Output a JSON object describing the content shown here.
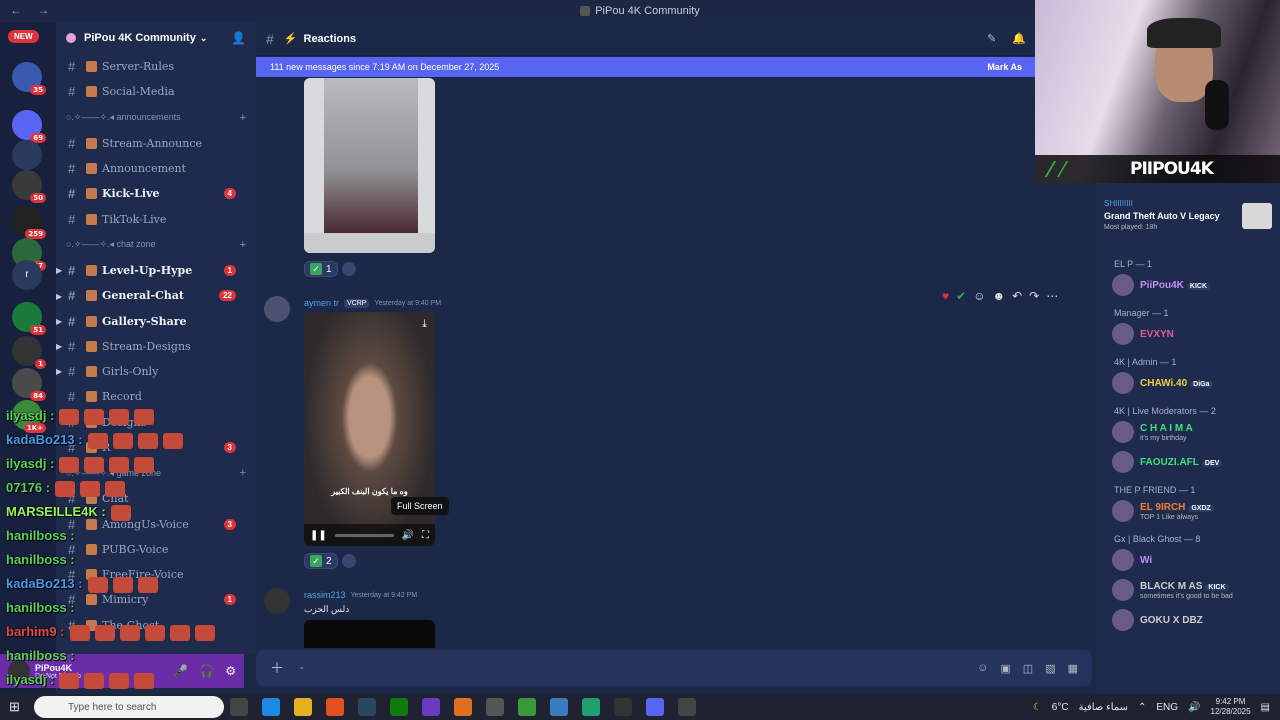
{
  "window": {
    "title": "PiPou 4K Community",
    "nav": "← →"
  },
  "rail": {
    "new_label": "NEW",
    "badges": [
      "35",
      "69",
      "50",
      "259",
      "287",
      "51",
      "1",
      "84",
      "1K+"
    ],
    "letter": "r"
  },
  "sidebar": {
    "guild_name": "PiPou 4K Community",
    "channels": [
      {
        "name": "Server-Rules"
      },
      {
        "name": "Social-Media"
      },
      {
        "category": "announcements"
      },
      {
        "name": "Stream-Announce"
      },
      {
        "name": "Announcement"
      },
      {
        "name": "Kick-Live",
        "badge": "4"
      },
      {
        "name": "TikTok-Live"
      },
      {
        "category": "chat zone"
      },
      {
        "name": "Level-Up-Hype",
        "badge": "1"
      },
      {
        "name": "General-Chat",
        "badge": "22"
      },
      {
        "name": "Gallery-Share"
      },
      {
        "name": "Stream-Designs"
      },
      {
        "name": "Girls-Only"
      },
      {
        "name": "Record"
      },
      {
        "name": "Designs"
      },
      {
        "name": "R",
        "badge": "3"
      },
      {
        "category": "game zone"
      },
      {
        "name": "Chat"
      },
      {
        "name": "AmongUs-Voice",
        "badge": "3"
      },
      {
        "name": "PUBG-Voice"
      },
      {
        "name": "FreeFire-Voice"
      },
      {
        "name": "Mimicry",
        "badge": "1"
      },
      {
        "name": "The-Ghost"
      }
    ]
  },
  "user_panel": {
    "name": "PiPou4K",
    "status": "Do Not Disturb"
  },
  "chat": {
    "channel": "Reactions",
    "banner_text": "111 new messages since 7:19 AM on December 27, 2025",
    "banner_action": "Mark As",
    "msg1_reaction_count": "1",
    "msg2": {
      "author": "aymen tr",
      "tag": "VCRP",
      "time": "Yesterday at 9:40 PM",
      "caption": "وه ما يكون البنف الكبير",
      "tooltip": "Full Screen",
      "reaction_count": "2"
    },
    "msg3": {
      "author": "rassim213",
      "time": "Yesterday at 9:42 PM",
      "text": "دلس الحزب"
    },
    "composer_placeholder": "-"
  },
  "webcam": {
    "brand": "PIIPOU4K"
  },
  "members": {
    "activity": {
      "user": "SHIIIIIIII",
      "game": "Grand Theft Auto V Legacy",
      "played": "Most played: 18h"
    },
    "groups": [
      {
        "label": "EL P — 1",
        "members": [
          {
            "name": "PiiPou4K",
            "tag": "KICK",
            "status": "",
            "color": "#c38ef5"
          }
        ]
      },
      {
        "label": "Manager — 1",
        "members": [
          {
            "name": "EVXYN",
            "tag": "",
            "status": "",
            "color": "#e05a9a"
          }
        ]
      },
      {
        "label": "4K | Admin — 1",
        "members": [
          {
            "name": "CHAWi.40",
            "tag": "DiGa",
            "status": "",
            "color": "#f0d040"
          }
        ]
      },
      {
        "label": "4K | Live Moderators — 2",
        "members": [
          {
            "name": "C H A I M A",
            "tag": "",
            "status": "it's my birthday",
            "color": "#40e080"
          },
          {
            "name": "FAOUZI.AFL",
            "tag": "DEV",
            "status": "",
            "color": "#40e080"
          }
        ]
      },
      {
        "label": "THE P FRIEND — 1",
        "members": [
          {
            "name": "EL 9IRCH",
            "tag": "GXDZ",
            "status": "TOP 1 Like always",
            "color": "#f08030"
          }
        ]
      },
      {
        "label": "Gx | Black Ghost — 8",
        "members": [
          {
            "name": "Wi",
            "tag": "",
            "status": "",
            "color": "#c38ef5"
          },
          {
            "name": "BLACK M AS",
            "tag": "KICK",
            "status": "sometimes it's good to be bad",
            "color": "#cccccc"
          },
          {
            "name": "GOKU X DBZ",
            "tag": "",
            "status": "",
            "color": "#cccccc"
          }
        ]
      }
    ]
  },
  "overlay_lines": [
    {
      "user": "ilyasdj",
      "color": "#5ad05a"
    },
    {
      "user": "kadaBo213",
      "color": "#4a9ae8"
    },
    {
      "user": "ilyasdj",
      "color": "#5ad05a"
    },
    {
      "user": "07176",
      "color": "#5ad05a"
    },
    {
      "user": "MARSEILLE4K",
      "color": "#9af05a"
    },
    {
      "user": "hanilboss",
      "color": "#5ad05a"
    },
    {
      "user": "hanilboss",
      "color": "#5ad05a"
    },
    {
      "user": "kadaBo213",
      "color": "#4a9ae8"
    },
    {
      "user": "hanilboss",
      "color": "#5ad05a"
    },
    {
      "user": "barhim9",
      "color": "#e84a4a"
    },
    {
      "user": "hanilboss",
      "color": "#5ad05a"
    },
    {
      "user": "ilyasdj",
      "color": "#5ad05a"
    },
    {
      "user": "hanilboss",
      "color": "#5ad05a"
    }
  ],
  "taskbar": {
    "search_placeholder": "Type here to search",
    "weather": "6°C",
    "weather_text": "سماء صافية",
    "lang": "ENG",
    "time": "9:42 PM",
    "date": "12/28/2025"
  }
}
